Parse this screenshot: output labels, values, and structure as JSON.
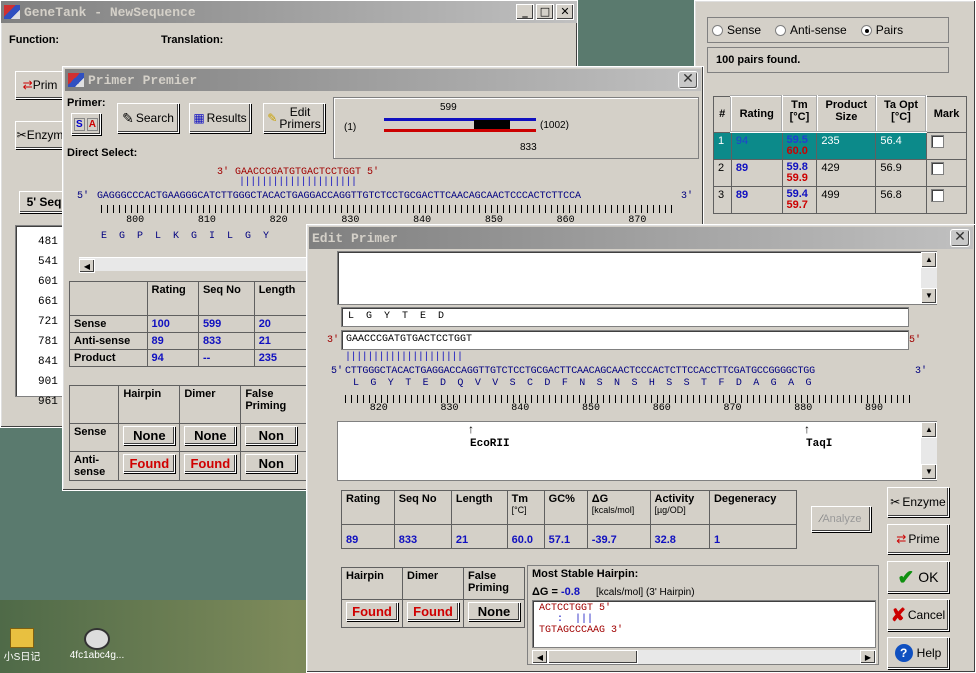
{
  "genetank": {
    "title": "GeneTank - NewSequence",
    "function_label": "Function:",
    "translation_label": "Translation:",
    "primer_btn": "Prim",
    "enzyme_btn": "Enzym",
    "seq_btn": "5' Seq",
    "rows": [
      "481",
      "541",
      "601",
      "661",
      "721",
      "781",
      "841",
      "901",
      "961"
    ]
  },
  "primer_premier": {
    "title": "Primer Premier",
    "primer_label": "Primer:",
    "s_btn": "S",
    "a_btn": "A",
    "search": "Search",
    "results": "Results",
    "edit_primers": "Edit\nPrimers",
    "map_left": "(1)",
    "map_right": "(1002)",
    "map_top": "599",
    "map_bottom": "833",
    "direct_select": "Direct Select:",
    "seq_primer": "3' GAACCCGATGTGACTCCTGGT 5'",
    "seq_bars": "|||||||||||||||||||||",
    "seq_main_5": "5'",
    "seq_main": "GAGGGCCCACTGAAGGGCATCTTGGGCTACACTGAGGACCAGGTTGTCTCCTGCGACTTCAACAGCAACTCCCACTCTTCCA",
    "seq_main_3": "3'",
    "ruler": [
      "800",
      "810",
      "820",
      "830",
      "840",
      "850",
      "860",
      "870"
    ],
    "aa": "E  G  P  L  K  G  I  L  G  Y",
    "table1": {
      "headers": [
        "",
        "Rating",
        "Seq No",
        "Length"
      ],
      "rows": [
        [
          "Sense",
          "100",
          "599",
          "20"
        ],
        [
          "Anti-sense",
          "89",
          "833",
          "21"
        ],
        [
          "Product",
          "94",
          "--",
          "235"
        ]
      ]
    },
    "table2": {
      "headers": [
        "",
        "Hairpin",
        "Dimer",
        "False Priming"
      ],
      "rows": [
        [
          "Sense",
          "None",
          "None",
          "Non"
        ],
        [
          "Anti-sense",
          "Found",
          "Found",
          "Non"
        ]
      ]
    }
  },
  "right_panel": {
    "radios": [
      "Sense",
      "Anti-sense",
      "Pairs"
    ],
    "selected": "Pairs",
    "found": "100 pairs found.",
    "headers": [
      "#",
      "Rating",
      "Tm\n[°C]",
      "Product\nSize",
      "Ta Opt\n[°C]",
      "Mark"
    ],
    "rows": [
      {
        "n": "1",
        "rating": "94",
        "tm1": "59.5",
        "tm2": "60.0",
        "size": "235",
        "ta": "56.4"
      },
      {
        "n": "2",
        "rating": "89",
        "tm1": "59.8",
        "tm2": "59.9",
        "size": "429",
        "ta": "56.9"
      },
      {
        "n": "3",
        "rating": "89",
        "tm1": "59.4",
        "tm2": "59.7",
        "size": "499",
        "ta": "56.8"
      }
    ]
  },
  "edit_primer": {
    "title": "Edit Primer",
    "aa_box": "L  G  Y  T  E  D",
    "primer_3": "3'",
    "primer_seq": "GAACCCGATGTGACTCCTGGT",
    "primer_5": "5'",
    "bars": "|||||||||||||||||||||",
    "main_5": "5'",
    "main_seq": "CTTGGGCTACACTGAGGACCAGGTTGTCTCCTGCGACTTCAACAGCAACTCCCACTCTTCCACCTTCGATGCCGGGGCTGG",
    "main_3": "3'",
    "aa2": "L  G  Y  T  E  D  Q  V  V  S  C  D  F  N  S  N  S  H  S  S  T  F  D  A  G  A  G",
    "ruler": [
      "820",
      "830",
      "840",
      "850",
      "860",
      "870",
      "880",
      "890"
    ],
    "enzymes": [
      "EcoRII",
      "TaqI"
    ],
    "stats": {
      "headers": [
        "Rating",
        "Seq No",
        "Length",
        "Tm",
        "GC%",
        "ΔG",
        "Activity",
        "Degeneracy"
      ],
      "units": [
        "",
        "",
        "",
        "[°C]",
        "",
        "[kcals/mol]",
        "[µg/OD]",
        ""
      ],
      "values": [
        "89",
        "833",
        "21",
        "60.0",
        "57.1",
        "-39.7",
        "32.8",
        "1"
      ]
    },
    "analyze": "Analyze",
    "hair_headers": [
      "Hairpin",
      "Dimer",
      "False Priming"
    ],
    "hair_values": [
      "Found",
      "Found",
      "None"
    ],
    "stable_title": "Most Stable Hairpin:",
    "dg_label": "ΔG = ",
    "dg_value": "-0.8",
    "dg_unit": "[kcals/mol] (3' Hairpin)",
    "hp_line1": "ACTCCTGGT 5'",
    "hp_line2": "   :  |||",
    "hp_line3": "TGTAGCCCAAG 3'",
    "buttons": {
      "enzyme": "Enzyme",
      "prime": "Prime",
      "ok": "OK",
      "cancel": "Cancel",
      "help": "Help"
    }
  },
  "desktop": {
    "icon1": "小S日记",
    "icon2": "4fc1abc4g..."
  }
}
